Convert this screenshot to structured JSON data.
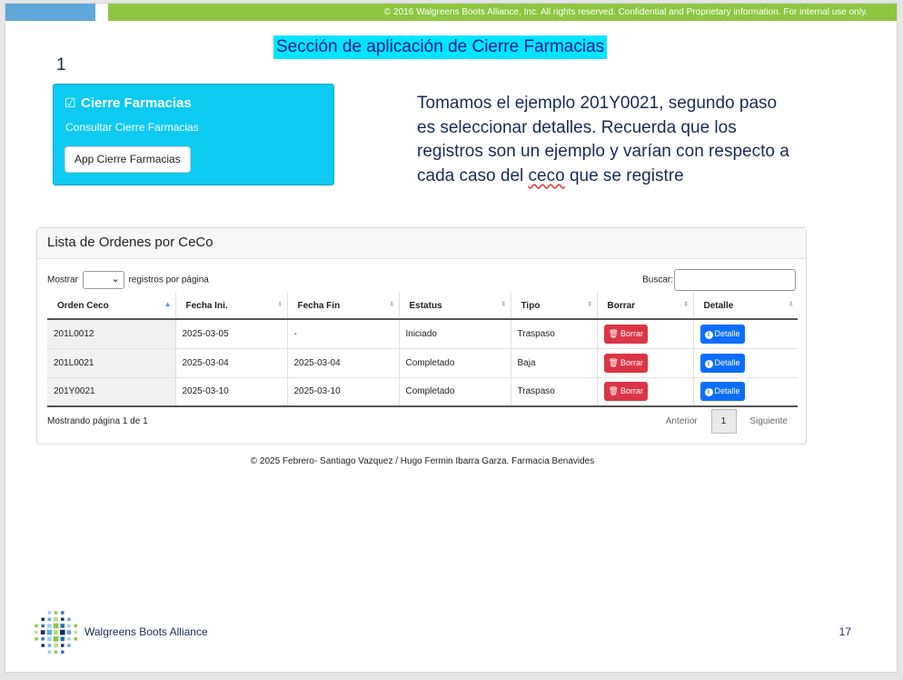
{
  "banner": {
    "copyright": "© 2016 Walgreens Boots Alliance, Inc. All rights reserved. Confidential and Proprietary information. For internal use only."
  },
  "slide": {
    "section_title": "Sección de aplicación  de Cierre Farmacias",
    "step_number": "1",
    "instruction": {
      "part1": "Tomamos el ejemplo 201Y0021, segundo paso es seleccionar detalles. Recuerda que los registros son un ejemplo y varían con respecto a cada caso del ",
      "squiggle_word": "ceco",
      "part2": " que se registre"
    },
    "page_number": "17",
    "logo_text": "Walgreens Boots Alliance"
  },
  "app_card": {
    "icon": "list-check-icon",
    "title": "Cierre Farmacias",
    "subtitle": "Consultar Cierre Farmacias",
    "button_label": "App Cierre Farmacias"
  },
  "panel": {
    "title": "Lista de Ordenes por CeCo",
    "show_prefix": "Mostrar",
    "show_suffix": "registros por página",
    "search_label": "Buscar:",
    "columns": [
      "Orden Ceco",
      "Fecha Ini.",
      "Fecha Fin",
      "Estatus",
      "Tipo",
      "Borrar",
      "Detalle"
    ],
    "rows": [
      {
        "orden": "201L0012",
        "fecha_ini": "2025-03-05",
        "fecha_fin": "-",
        "estatus": "Iniciado",
        "tipo": "Traspaso"
      },
      {
        "orden": "201L0021",
        "fecha_ini": "2025-03-04",
        "fecha_fin": "2025-03-04",
        "estatus": "Completado",
        "tipo": "Baja"
      },
      {
        "orden": "201Y0021",
        "fecha_ini": "2025-03-10",
        "fecha_fin": "2025-03-10",
        "estatus": "Completado",
        "tipo": "Traspaso"
      }
    ],
    "delete_label": "Borrar",
    "detail_label": "Detalle",
    "info": "Mostrando página 1 de 1",
    "prev_label": "Anterior",
    "current_page": "1",
    "next_label": "Siguiente"
  },
  "footer": {
    "credit": "© 2025 Febrero- Santiago Vazquez / Hugo Fermin Ibarra Garza. Farmacia Benavides"
  },
  "colors": {
    "cyan_card": "#0dcaf0",
    "title_highlight": "#00e5ff",
    "banner_green": "#8dc63f",
    "banner_blue": "#5fa8d9",
    "danger": "#dc3545",
    "primary": "#0d6efd",
    "navy_text": "#1b2a57"
  }
}
